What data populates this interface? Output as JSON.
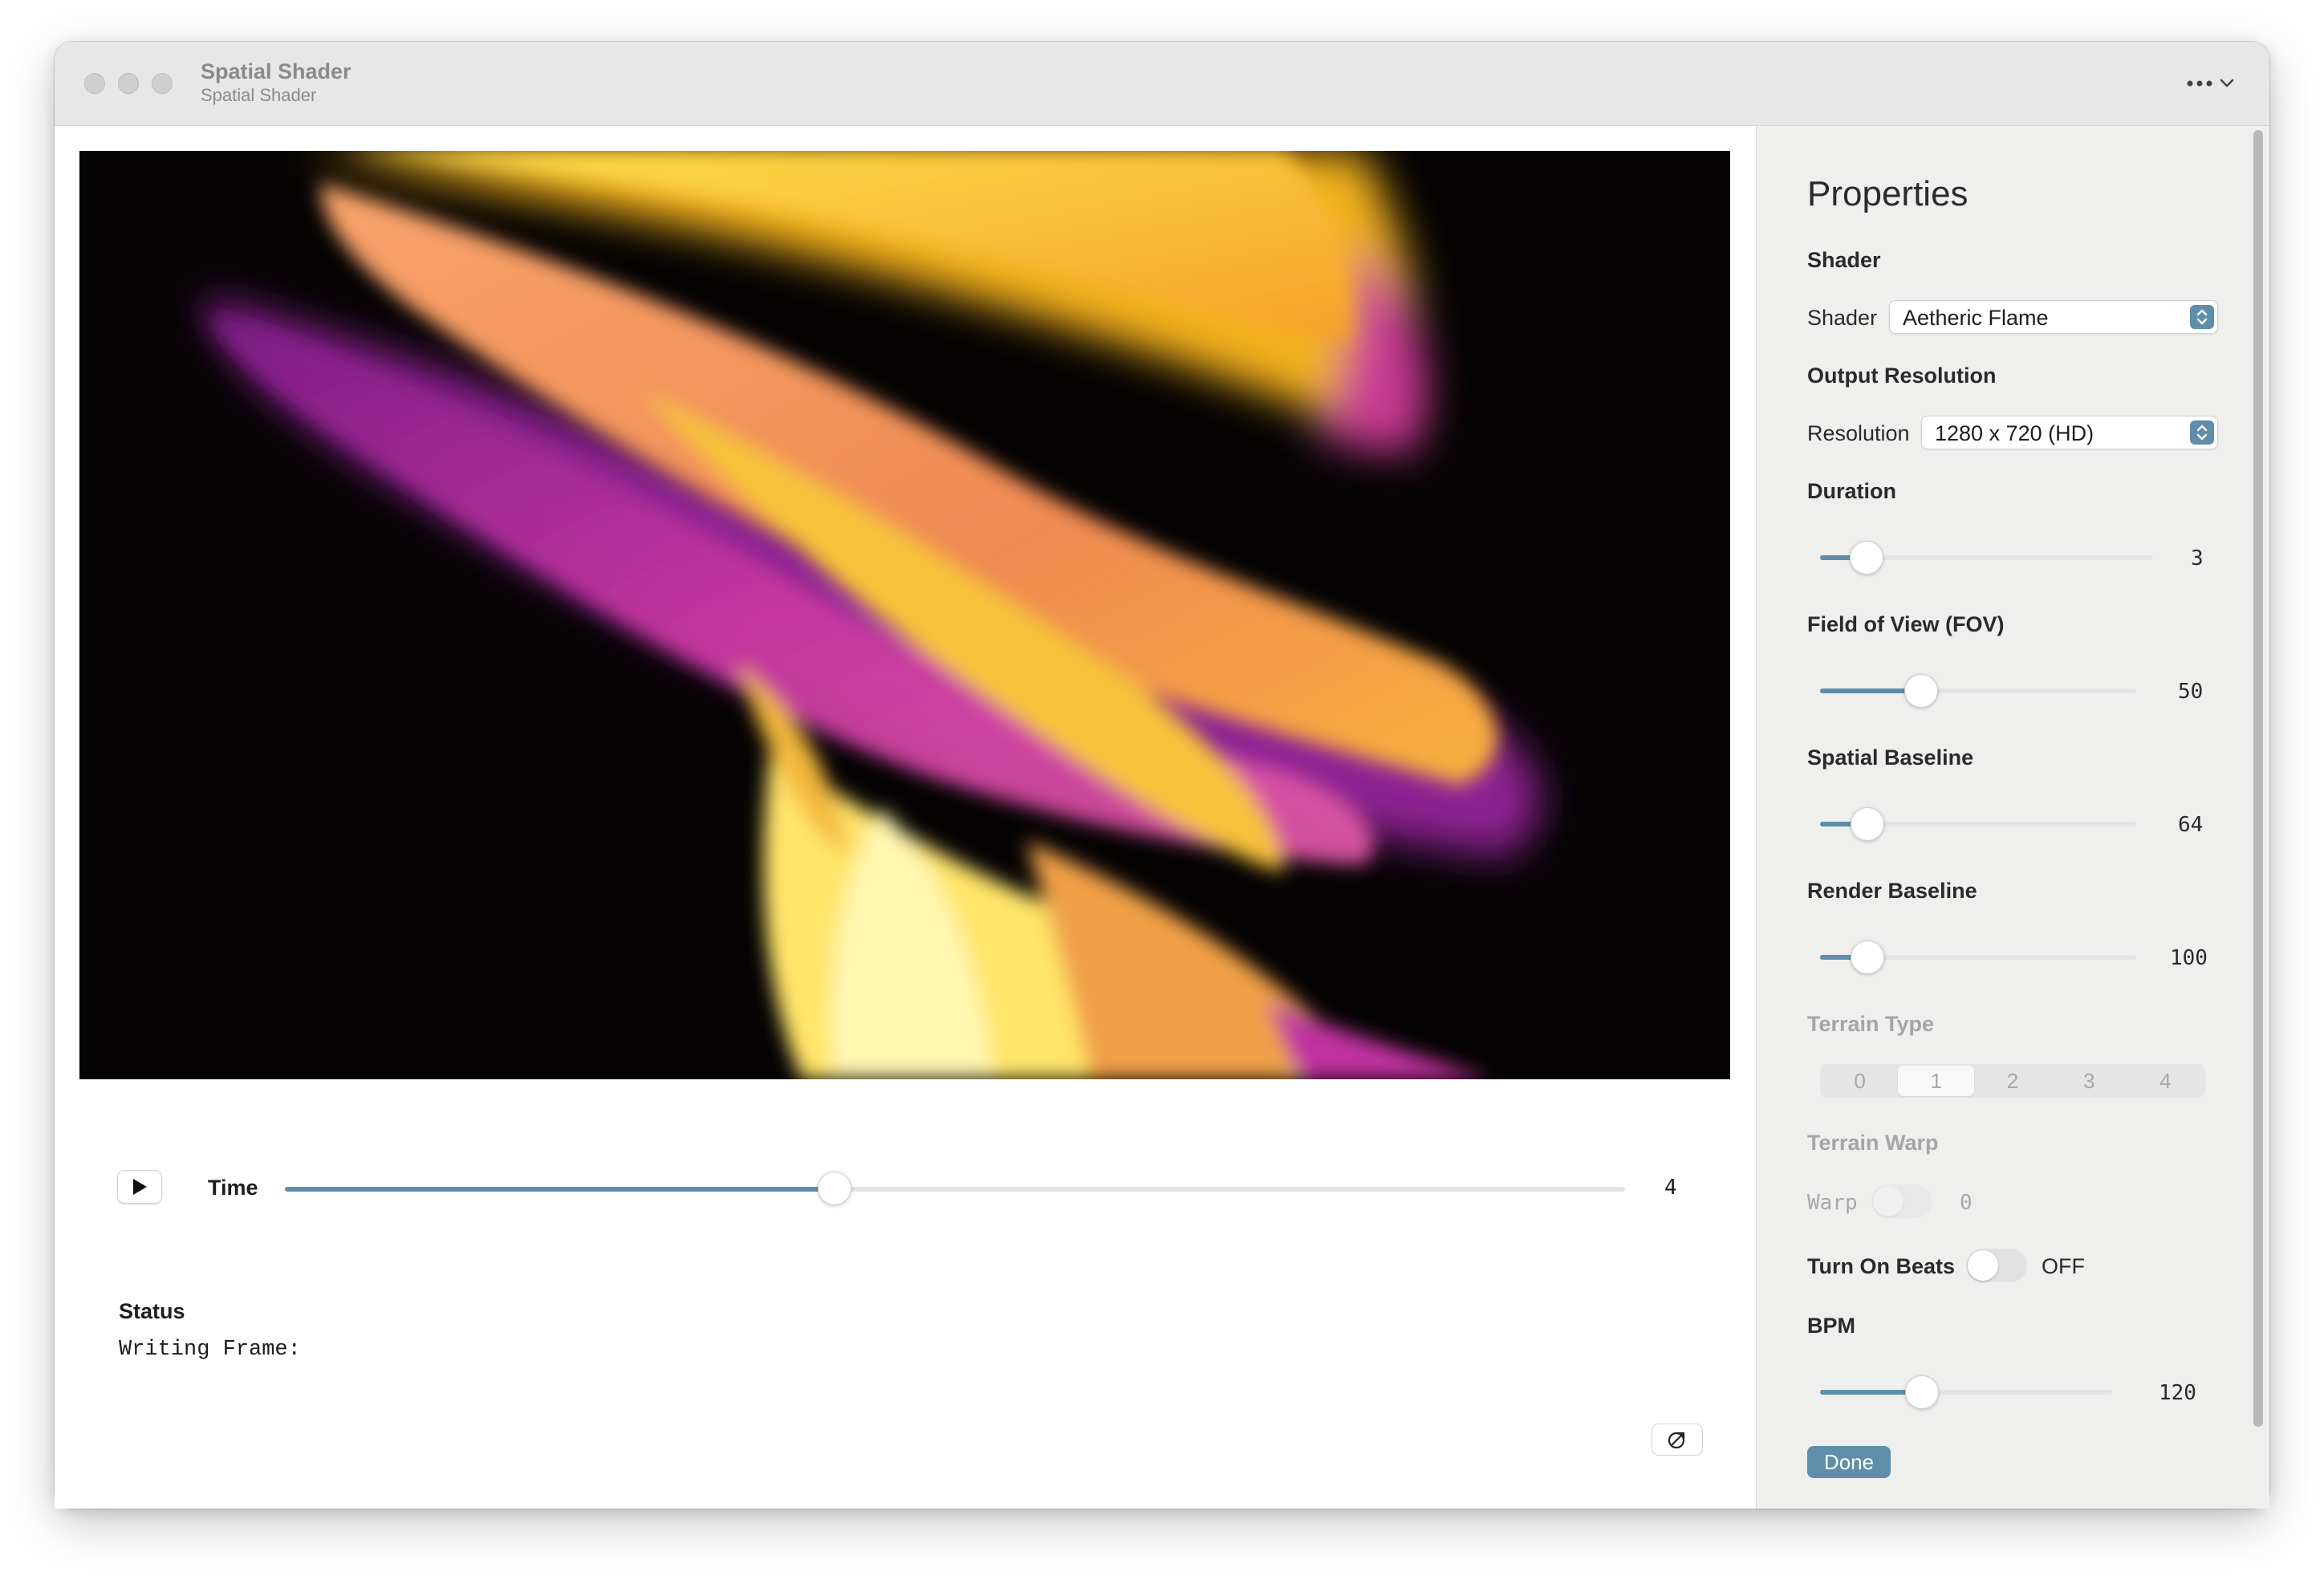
{
  "window": {
    "title": "Spatial Shader",
    "subtitle": "Spatial Shader"
  },
  "playback": {
    "time_label": "Time",
    "time_value": "4",
    "time_fraction": 0.41
  },
  "status": {
    "label": "Status",
    "text": "Writing Frame:"
  },
  "panel": {
    "title": "Properties",
    "shader_section": "Shader",
    "shader_label": "Shader",
    "shader_value": "Aetheric Flame",
    "resolution_section": "Output Resolution",
    "resolution_label": "Resolution",
    "resolution_value": "1280 x 720 (HD)",
    "duration": {
      "label": "Duration",
      "value": "3",
      "fraction": 0.14
    },
    "fov": {
      "label": "Field of View (FOV)",
      "value": "50",
      "fraction": 0.32
    },
    "spatial_baseline": {
      "label": "Spatial Baseline",
      "value": "64",
      "fraction": 0.15
    },
    "render_baseline": {
      "label": "Render Baseline",
      "value": "100",
      "fraction": 0.15
    },
    "terrain_type": {
      "label": "Terrain Type",
      "options": [
        "0",
        "1",
        "2",
        "3",
        "4"
      ],
      "selected": "1"
    },
    "terrain_warp": {
      "label": "Terrain Warp",
      "warp_label": "Warp",
      "warp_value": "0"
    },
    "beats": {
      "label": "Turn On Beats",
      "state": "OFF"
    },
    "bpm": {
      "label": "BPM",
      "value": "120",
      "fraction": 0.35
    },
    "done_label": "Done"
  },
  "colors": {
    "accent": "#5e8ea9",
    "render_background": "#050303",
    "flame_yellow": "#ffd21a",
    "flame_orange": "#f59a4a",
    "flame_magenta": "#c0319f"
  },
  "icons": {
    "play": "play-icon",
    "more": "ellipsis-icon",
    "chevron": "chevron-down-icon",
    "corner": "circle-slash-icon",
    "stepper": "up-down-chevron-icon"
  }
}
